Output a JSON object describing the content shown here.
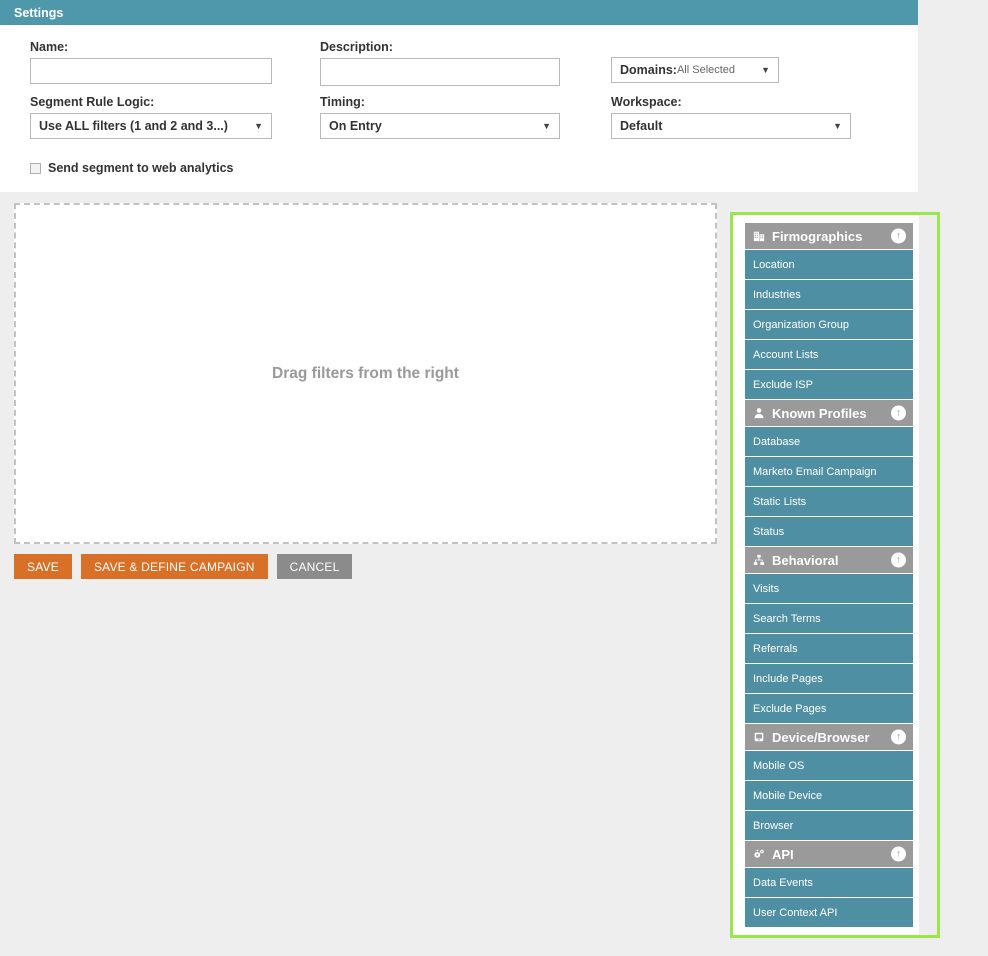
{
  "settings": {
    "title": "Settings",
    "name": {
      "label": "Name:",
      "value": "",
      "placeholder": ""
    },
    "description": {
      "label": "Description:",
      "value": "",
      "placeholder": ""
    },
    "domains": {
      "label": "Domains:",
      "value": "All Selected",
      "caret": "▼"
    },
    "segment_rule_logic": {
      "label": "Segment Rule Logic:",
      "value": "Use ALL filters (1 and 2 and 3...)",
      "caret": "▼"
    },
    "timing": {
      "label": "Timing:",
      "value": "On Entry",
      "caret": "▼"
    },
    "workspace": {
      "label": "Workspace:",
      "value": "Default",
      "caret": "▼"
    },
    "web_analytics": {
      "label": "Send segment to web analytics",
      "checked": false
    }
  },
  "dropzone": {
    "text": "Drag filters from the right"
  },
  "actions": {
    "save": "SAVE",
    "save_define_campaign": "SAVE & DEFINE CAMPAIGN",
    "cancel": "CANCEL"
  },
  "filter_panel": {
    "collapse_icon": "↑",
    "groups": [
      {
        "title": "Firmographics",
        "icon": "building-icon",
        "items": [
          "Location",
          "Industries",
          "Organization Group",
          "Account Lists",
          "Exclude ISP"
        ]
      },
      {
        "title": "Known Profiles",
        "icon": "person-icon",
        "items": [
          "Database",
          "Marketo Email Campaign",
          "Static Lists",
          "Status"
        ]
      },
      {
        "title": "Behavioral",
        "icon": "sitemap-icon",
        "items": [
          "Visits",
          "Search Terms",
          "Referrals",
          "Include Pages",
          "Exclude Pages"
        ]
      },
      {
        "title": "Device/Browser",
        "icon": "mobile-device-icon",
        "items": [
          "Mobile OS",
          "Mobile Device",
          "Browser"
        ]
      },
      {
        "title": "API",
        "icon": "gears-icon",
        "items": [
          "Data Events",
          "User Context API"
        ]
      }
    ]
  },
  "colors": {
    "titlebar": "#4f98ab",
    "filter_item": "#4f8fa3",
    "group_header": "#9a9a9a",
    "highlight_border": "#9ae64b",
    "primary_button": "#d97028",
    "cancel_button": "#8b8b8b"
  }
}
